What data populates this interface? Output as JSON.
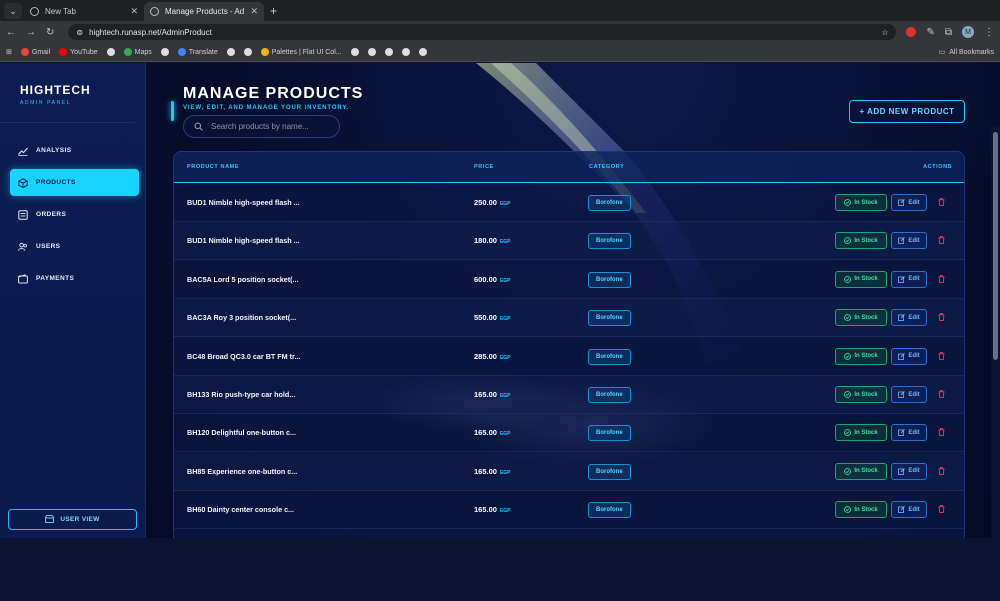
{
  "browser": {
    "tabs": [
      {
        "title": "New Tab",
        "active": false
      },
      {
        "title": "Manage Products - Admin Pan",
        "active": true
      }
    ],
    "url": "hightech.runasp.net/AdminProduct",
    "bookmarks": [
      "Gmail",
      "YouTube",
      "Maps",
      "Translate",
      "Palettes | Flat UI Col..."
    ],
    "all_bookmarks_label": "All Bookmarks",
    "profile_initial": "M"
  },
  "sidebar": {
    "brand_title": "HIGHTECH",
    "brand_subtitle": "ADMIN PANEL",
    "items": [
      {
        "label": "ANALYSIS",
        "icon": "chart-line-icon",
        "active": false
      },
      {
        "label": "PRODUCTS",
        "icon": "box-icon",
        "active": true
      },
      {
        "label": "ORDERS",
        "icon": "list-icon",
        "active": false
      },
      {
        "label": "USERS",
        "icon": "users-icon",
        "active": false
      },
      {
        "label": "PAYMENTS",
        "icon": "wallet-icon",
        "active": false
      }
    ],
    "user_view_label": "USER VIEW"
  },
  "header": {
    "title": "MANAGE PRODUCTS",
    "subtitle": "VIEW, EDIT, AND MANAGE YOUR INVENTORY.",
    "search_placeholder": "Search products by name...",
    "add_button": "+ ADD NEW PRODUCT"
  },
  "table": {
    "columns": [
      "PRODUCT NAME",
      "PRICE",
      "CATEGORY",
      "ACTIONS"
    ],
    "rows": [
      {
        "name": "BUD1 Nimble high-speed flash ...",
        "price": "250.00",
        "currency": "EGP",
        "category": "Borofone",
        "status": "In Stock",
        "edit": "Edit"
      },
      {
        "name": "BUD1 Nimble high-speed flash ...",
        "price": "180.00",
        "currency": "EGP",
        "category": "Borofone",
        "status": "In Stock",
        "edit": "Edit"
      },
      {
        "name": "BAC5A Lord 5 position socket(...",
        "price": "600.00",
        "currency": "EGP",
        "category": "Borofone",
        "status": "In Stock",
        "edit": "Edit"
      },
      {
        "name": "BAC3A Roy 3 position socket(...",
        "price": "550.00",
        "currency": "EGP",
        "category": "Borofone",
        "status": "In Stock",
        "edit": "Edit"
      },
      {
        "name": "BC48 Broad QC3.0 car BT FM tr...",
        "price": "285.00",
        "currency": "EGP",
        "category": "Borofone",
        "status": "In Stock",
        "edit": "Edit"
      },
      {
        "name": "BH133 Rio push-type car hold...",
        "price": "165.00",
        "currency": "EGP",
        "category": "Borofone",
        "status": "In Stock",
        "edit": "Edit"
      },
      {
        "name": "BH120 Delightful one-button c...",
        "price": "165.00",
        "currency": "EGP",
        "category": "Borofone",
        "status": "In Stock",
        "edit": "Edit"
      },
      {
        "name": "BH85 Experience one-button c...",
        "price": "165.00",
        "currency": "EGP",
        "category": "Borofone",
        "status": "In Stock",
        "edit": "Edit"
      },
      {
        "name": "BH60 Dainty center console c...",
        "price": "165.00",
        "currency": "EGP",
        "category": "Borofone",
        "status": "In Stock",
        "edit": "Edit"
      }
    ]
  },
  "colors": {
    "accent": "#19c8ff",
    "sidebar_bg": "#0b1d52",
    "stock_green": "#39e39a",
    "delete_red": "#e0405a"
  }
}
